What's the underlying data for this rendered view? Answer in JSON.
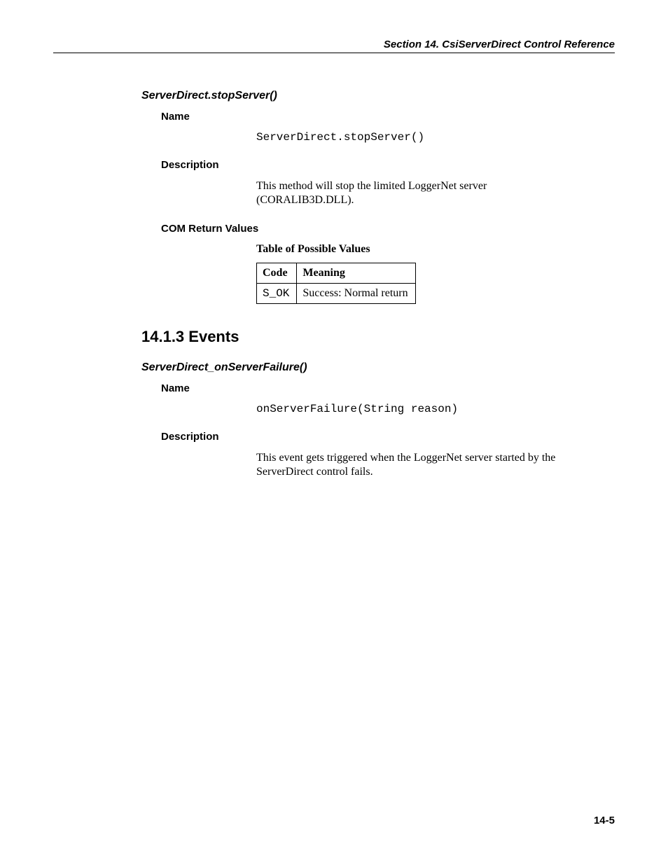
{
  "header": {
    "running_title": "Section 14.  CsiServerDirect Control Reference"
  },
  "method1": {
    "title": "ServerDirect.stopServer()",
    "name_label": "Name",
    "name_value": "ServerDirect.stopServer()",
    "description_label": "Description",
    "description_text": "This method will stop the limited LoggerNet server (CORALIB3D.DLL).",
    "com_label": "COM Return Values",
    "table_title": "Table of Possible Values",
    "table": {
      "col_code": "Code",
      "col_meaning": "Meaning",
      "rows": [
        {
          "code": "S_OK",
          "meaning": "Success: Normal return"
        }
      ]
    }
  },
  "section": {
    "heading": "14.1.3  Events"
  },
  "event1": {
    "title": "ServerDirect_onServerFailure()",
    "name_label": "Name",
    "name_value": "onServerFailure(String reason)",
    "description_label": "Description",
    "description_text": "This event gets triggered when the LoggerNet server started by the ServerDirect control fails."
  },
  "footer": {
    "page_number": "14-5"
  }
}
